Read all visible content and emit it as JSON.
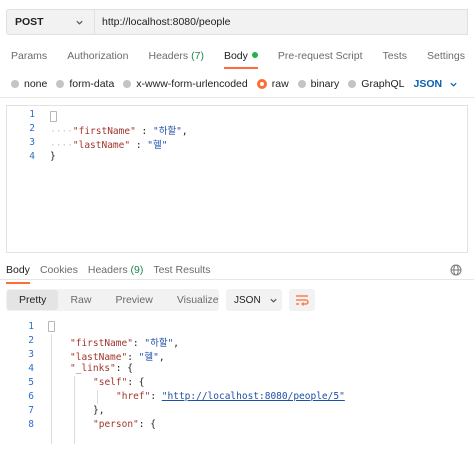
{
  "request": {
    "method": "POST",
    "url": "http://localhost:8080/people"
  },
  "request_tabs": [
    {
      "label": "Params"
    },
    {
      "label": "Authorization"
    },
    {
      "label": "Headers",
      "count": "(7)"
    },
    {
      "label": "Body"
    },
    {
      "label": "Pre-request Script"
    },
    {
      "label": "Tests"
    },
    {
      "label": "Settings"
    }
  ],
  "body_types": [
    "none",
    "form-data",
    "x-www-form-urlencoded",
    "raw",
    "binary",
    "GraphQL"
  ],
  "body_format": "JSON",
  "request_body_lines": {
    "numbers": [
      "1",
      "2",
      "3",
      "4"
    ],
    "l1": "{",
    "l2_key": "\"firstName\"",
    "l2_sep": " : ",
    "l2_val": "\"하할\"",
    "l2_end": ",",
    "l3_key": "\"lastName\"",
    "l3_sep": " : ",
    "l3_val": "\"헬\"",
    "l4": "}"
  },
  "response_tabs": [
    {
      "label": "Body"
    },
    {
      "label": "Cookies"
    },
    {
      "label": "Headers",
      "count": "(9)"
    },
    {
      "label": "Test Results"
    }
  ],
  "response_views": [
    "Pretty",
    "Raw",
    "Preview",
    "Visualize"
  ],
  "response_format": "JSON",
  "response_body_lines": {
    "numbers": [
      "1",
      "2",
      "3",
      "4",
      "5",
      "6",
      "7",
      "8"
    ],
    "l1": "{",
    "l2_key": "\"firstName\"",
    "l2_sep": ": ",
    "l2_val": "\"하할\"",
    "l2_end": ",",
    "l3_key": "\"lastName\"",
    "l3_sep": ": ",
    "l3_val": "\"헬\"",
    "l3_end": ",",
    "l4_key": "\"_links\"",
    "l4_rest": ": {",
    "l5_key": "\"self\"",
    "l5_rest": ": {",
    "l6_key": "\"href\"",
    "l6_sep": ": ",
    "l6_val": "\"http://localhost:8080/people/5\"",
    "l7": "},",
    "l8_key": "\"person\"",
    "l8_rest": ": {"
  },
  "colors": {
    "accent": "#ff6c37",
    "active_dot": "#26b04e",
    "json_blue": "#0b5fb5"
  }
}
